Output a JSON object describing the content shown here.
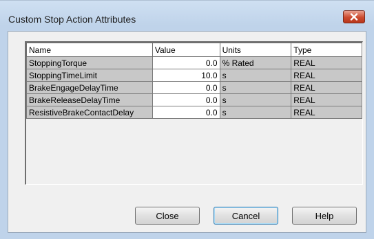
{
  "window": {
    "title": "Custom Stop Action Attributes",
    "close_icon": "close-icon",
    "close_color": "#cc4b2f"
  },
  "table": {
    "columns": [
      "Name",
      "Value",
      "Units",
      "Type"
    ],
    "rows": [
      {
        "name": "StoppingTorque",
        "value": "0.0",
        "units": "% Rated",
        "type": "REAL"
      },
      {
        "name": "StoppingTimeLimit",
        "value": "10.0",
        "units": "s",
        "type": "REAL"
      },
      {
        "name": "BrakeEngageDelayTime",
        "value": "0.0",
        "units": "s",
        "type": "REAL"
      },
      {
        "name": "BrakeReleaseDelayTime",
        "value": "0.0",
        "units": "s",
        "type": "REAL"
      },
      {
        "name": "ResistiveBrakeContactDelay",
        "value": "0.0",
        "units": "s",
        "type": "REAL"
      }
    ]
  },
  "buttons": {
    "close_label": "Close",
    "cancel_label": "Cancel",
    "help_label": "Help"
  }
}
